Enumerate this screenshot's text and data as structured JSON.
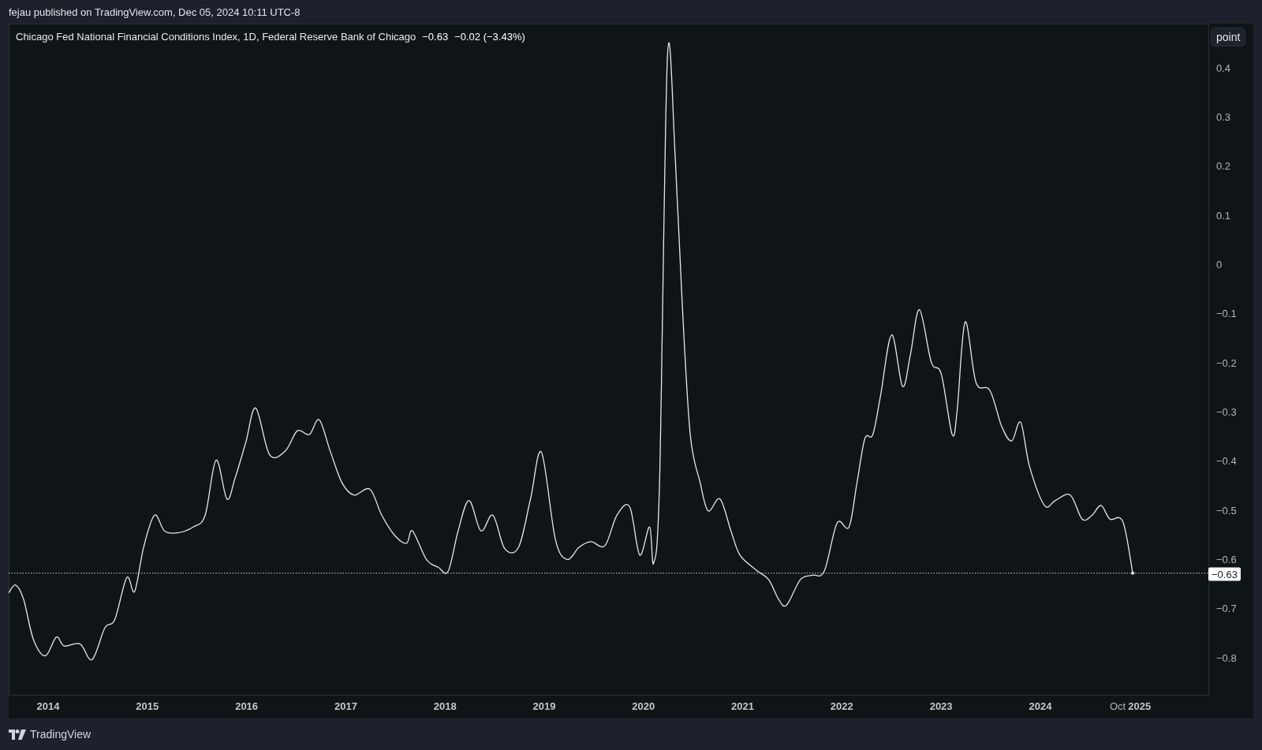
{
  "header": {
    "text": "fejau published on TradingView.com, Dec 05, 2024 10:11 UTC-8"
  },
  "legend": {
    "value": "−0.63",
    "change": "−0.02 (−3.43%)"
  },
  "scale_button": "point",
  "chart_data": {
    "type": "line",
    "xlim": [
      2013.61,
      2025.71
    ],
    "ylim": [
      -0.879,
      0.488
    ],
    "xticks": [
      {
        "value": 2014,
        "label": "2014"
      },
      {
        "value": 2015,
        "label": "2015"
      },
      {
        "value": 2016,
        "label": "2016"
      },
      {
        "value": 2017,
        "label": "2017"
      },
      {
        "value": 2018,
        "label": "2018"
      },
      {
        "value": 2019,
        "label": "2019"
      },
      {
        "value": 2020,
        "label": "2020"
      },
      {
        "value": 2021,
        "label": "2021"
      },
      {
        "value": 2022,
        "label": "2022"
      },
      {
        "value": 2023,
        "label": "2023"
      },
      {
        "value": 2024,
        "label": "2024"
      },
      {
        "value": 2024.78,
        "label": "Oct"
      },
      {
        "value": 2025,
        "label": "2025"
      }
    ],
    "yticks": [
      {
        "value": 0.4,
        "label": "0.4"
      },
      {
        "value": 0.3,
        "label": "0.3"
      },
      {
        "value": 0.2,
        "label": "0.2"
      },
      {
        "value": 0.1,
        "label": "0.1"
      },
      {
        "value": 0,
        "label": "0"
      },
      {
        "value": -0.1,
        "label": "−0.1"
      },
      {
        "value": -0.2,
        "label": "−0.2"
      },
      {
        "value": -0.3,
        "label": "−0.3"
      },
      {
        "value": -0.4,
        "label": "−0.4"
      },
      {
        "value": -0.5,
        "label": "−0.5"
      },
      {
        "value": -0.6,
        "label": "−0.6"
      },
      {
        "value": -0.7,
        "label": "−0.7"
      },
      {
        "value": -0.8,
        "label": "−0.8"
      }
    ],
    "x": [
      2013.61,
      2013.68,
      2013.76,
      2013.86,
      2013.98,
      2014.09,
      2014.17,
      2014.33,
      2014.45,
      2014.58,
      2014.68,
      2014.8,
      2014.88,
      2014.97,
      2015.08,
      2015.18,
      2015.31,
      2015.47,
      2015.59,
      2015.7,
      2015.81,
      2015.89,
      2016.0,
      2016.1,
      2016.24,
      2016.4,
      2016.52,
      2016.64,
      2016.74,
      2016.85,
      2016.97,
      2017.09,
      2017.25,
      2017.37,
      2017.5,
      2017.62,
      2017.68,
      2017.82,
      2017.94,
      2018.04,
      2018.14,
      2018.25,
      2018.37,
      2018.49,
      2018.61,
      2018.75,
      2018.87,
      2018.98,
      2019.12,
      2019.24,
      2019.36,
      2019.48,
      2019.62,
      2019.74,
      2019.87,
      2019.97,
      2020.07,
      2020.11,
      2020.17,
      2020.25,
      2020.33,
      2020.4,
      2020.48,
      2020.58,
      2020.66,
      2020.78,
      2020.89,
      2020.98,
      2021.14,
      2021.27,
      2021.37,
      2021.45,
      2021.59,
      2021.71,
      2021.83,
      2021.96,
      2022.08,
      2022.16,
      2022.24,
      2022.32,
      2022.4,
      2022.51,
      2022.62,
      2022.7,
      2022.79,
      2022.91,
      2023.01,
      2023.12,
      2023.17,
      2023.25,
      2023.36,
      2023.5,
      2023.62,
      2023.72,
      2023.81,
      2023.9,
      2024.05,
      2024.16,
      2024.31,
      2024.43,
      2024.53,
      2024.62,
      2024.71,
      2024.84,
      2024.94
    ],
    "series": [
      {
        "name": "Chicago Fed National Financial Conditions Index, 1D, Federal Reserve Bank of Chicago",
        "color": "#e6e8ee",
        "values": [
          -0.67,
          -0.654,
          -0.683,
          -0.765,
          -0.798,
          -0.76,
          -0.778,
          -0.774,
          -0.806,
          -0.741,
          -0.724,
          -0.639,
          -0.667,
          -0.577,
          -0.512,
          -0.544,
          -0.548,
          -0.536,
          -0.512,
          -0.4,
          -0.479,
          -0.438,
          -0.364,
          -0.294,
          -0.389,
          -0.381,
          -0.34,
          -0.348,
          -0.318,
          -0.381,
          -0.446,
          -0.471,
          -0.459,
          -0.512,
          -0.553,
          -0.569,
          -0.544,
          -0.602,
          -0.618,
          -0.626,
          -0.544,
          -0.482,
          -0.544,
          -0.512,
          -0.58,
          -0.577,
          -0.479,
          -0.384,
          -0.561,
          -0.602,
          -0.577,
          -0.566,
          -0.574,
          -0.512,
          -0.495,
          -0.593,
          -0.536,
          -0.61,
          -0.446,
          0.421,
          0.209,
          -0.086,
          -0.348,
          -0.446,
          -0.503,
          -0.479,
          -0.544,
          -0.593,
          -0.623,
          -0.643,
          -0.683,
          -0.695,
          -0.643,
          -0.634,
          -0.626,
          -0.528,
          -0.536,
          -0.446,
          -0.356,
          -0.348,
          -0.266,
          -0.145,
          -0.25,
          -0.184,
          -0.094,
          -0.201,
          -0.225,
          -0.348,
          -0.299,
          -0.119,
          -0.242,
          -0.258,
          -0.332,
          -0.361,
          -0.323,
          -0.413,
          -0.492,
          -0.482,
          -0.471,
          -0.52,
          -0.512,
          -0.492,
          -0.52,
          -0.525,
          -0.63
        ]
      }
    ],
    "ref_lines": [
      {
        "axis": "y",
        "value": -0.63,
        "label": "−0.63"
      }
    ]
  },
  "footer": {
    "logo_text": "TradingView"
  }
}
